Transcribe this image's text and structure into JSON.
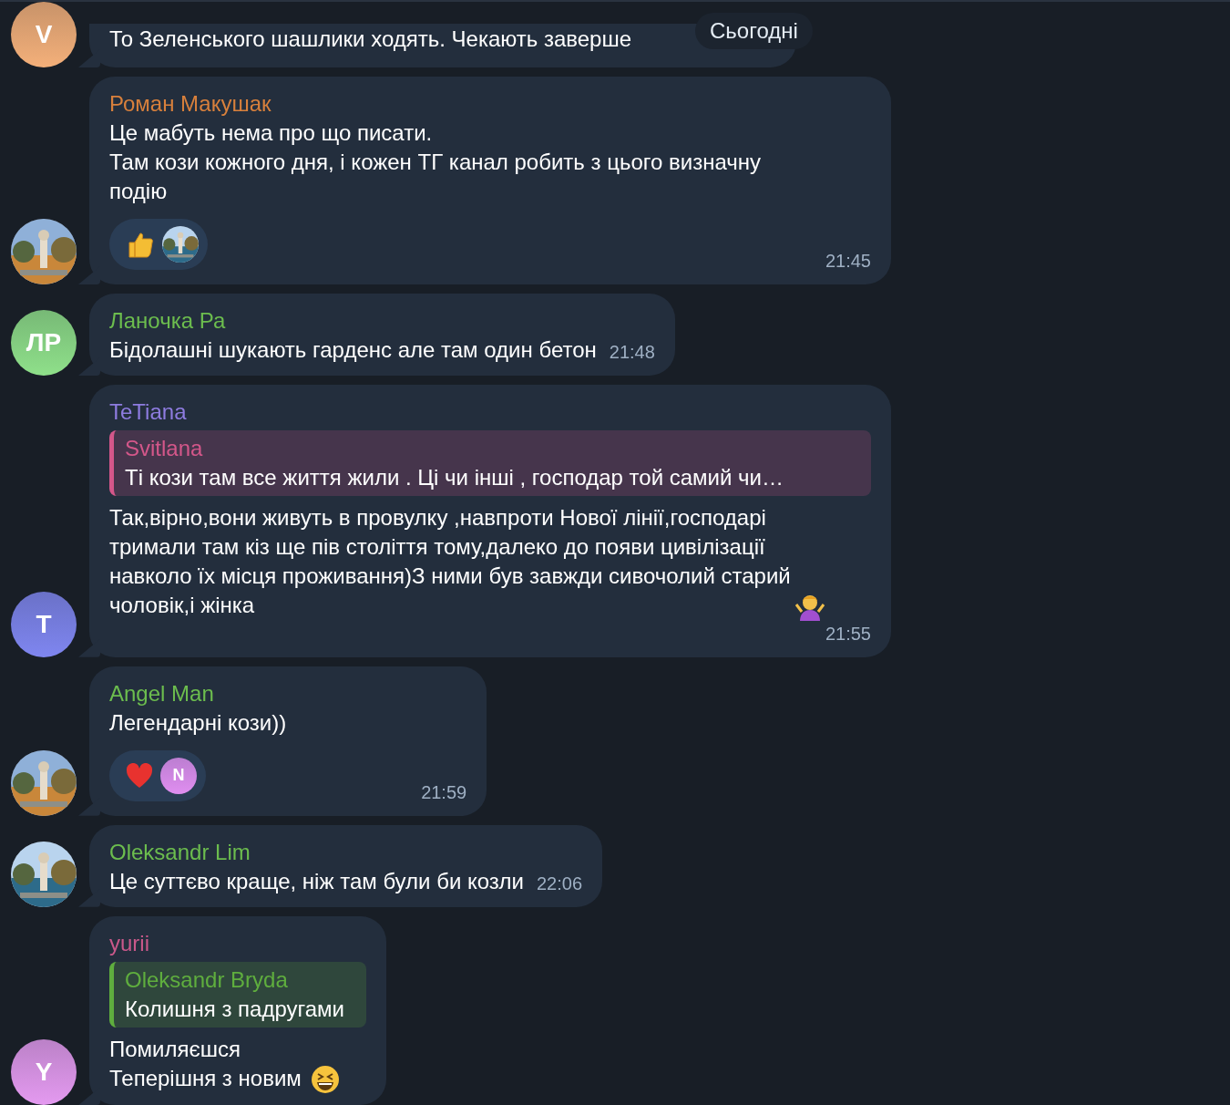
{
  "date_pill": "Сьогодні",
  "messages": [
    {
      "continued": true,
      "avatar": {
        "kind": "letter",
        "letter": "V",
        "color": "#f4b07a"
      },
      "text": "То Зеленського шашлики ходять. Чекають заверше"
    },
    {
      "continued": false,
      "author": "Роман Макушак",
      "color": "#d8803c",
      "text": "Це мабуть нема про що писати.\nТам кози кожного дня, і кожен ТГ канал робить з цього визначну\nподію",
      "reactions": [
        {
          "kind": "thumbs-up"
        }
      ],
      "time": "21:45"
    },
    {
      "continued": false,
      "author": "Ланочка Ра",
      "color": "#6cbd4e",
      "avatar": {
        "kind": "letter",
        "letter": "ЛР",
        "color": "#8fe08a"
      },
      "text": "Бідолашні шукають гарденс але там один бетон",
      "time": "21:48"
    },
    {
      "continued": false,
      "author": "TeTiana",
      "color": "#8e7ce0",
      "avatar": {
        "kind": "letter",
        "letter": "T",
        "color": "#7f86f0"
      },
      "reply": {
        "author": "Svitlana",
        "color": "#d4578a",
        "text": "Ті кози там все життя жили . Ці чи інші , господар той самий чи…"
      },
      "text": "Так,вірно,вони живуть в провулку ,навпроти Нової лінії,господарі\nтримали там кіз ще пів століття тому,далеко до появи цивілізації\nнавколо їх місця проживання)З ними був завжди сивочолий старий\nчоловік,і жінка",
      "emoji": {
        "kind": "shrugging-woman"
      },
      "time": "21:55"
    },
    {
      "continued": false,
      "author": "Angel Man",
      "color": "#6cbd4e",
      "text": "Легендарні кози))",
      "reactions": [
        {
          "kind": "heart",
          "user": {
            "kind": "letter",
            "letter": "N",
            "color": "#e08ef0"
          }
        }
      ],
      "time": "21:59"
    },
    {
      "continued": false,
      "author": "Oleksandr Lim",
      "color": "#6cbd4e",
      "text": "Це суттєво краще, ніж там були би козли",
      "time": "22:06"
    },
    {
      "continued": false,
      "author": "yurii",
      "color": "#c9588a",
      "avatar": {
        "kind": "letter",
        "letter": "Y",
        "color": "#e49af0"
      },
      "reply": {
        "author": "Oleksandr Bryda",
        "color": "#5fae3e",
        "text": "Колишня з падругами"
      },
      "text": "Помиляєшся\n Теперішня з новим",
      "emoji": {
        "kind": "laughing-face"
      }
    }
  ]
}
